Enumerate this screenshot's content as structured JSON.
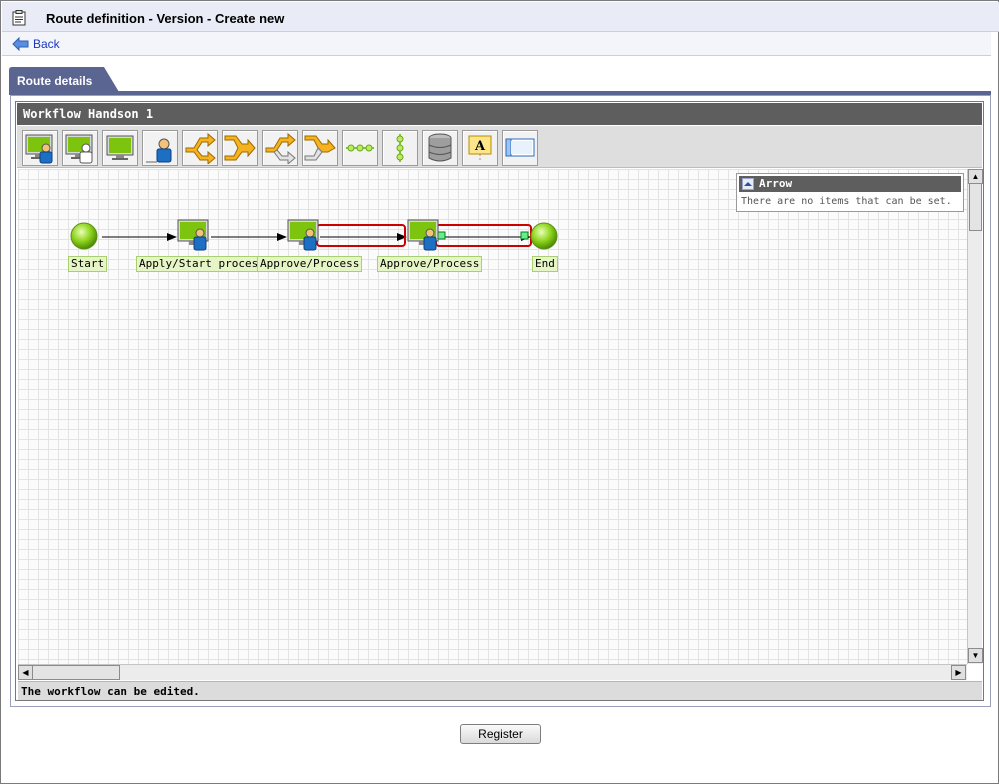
{
  "window": {
    "title": "Route definition - Version - Create new"
  },
  "nav": {
    "back_label": "Back"
  },
  "tabs": [
    {
      "label": "Route details"
    }
  ],
  "editor": {
    "workflow_title": "Workflow Handson 1",
    "toolbar_icons": [
      "apply-node-icon",
      "approve-node-icon",
      "process-node-icon",
      "user-node-icon",
      "branch-start-icon",
      "branch-end-icon",
      "parallel-branch-start-icon",
      "parallel-branch-end-icon",
      "horizontal-line-icon",
      "vertical-line-icon",
      "database-icon",
      "text-annotation-icon",
      "window-icon"
    ],
    "nodes": [
      {
        "label": "Start",
        "icon": "start-node-icon"
      },
      {
        "label": "Apply/Start process",
        "icon": "apply-node-icon"
      },
      {
        "label": "Approve/Process",
        "icon": "approve-node-icon"
      },
      {
        "label": "Approve/Process",
        "icon": "approve-node-icon"
      },
      {
        "label": "End",
        "icon": "end-node-icon"
      }
    ],
    "properties": {
      "title": "Arrow",
      "message": "There are no items that can be set."
    },
    "status": "The workflow can be edited."
  },
  "actions": {
    "register_label": "Register"
  },
  "colors": {
    "tab": "#5a6591",
    "header_dark": "#5e5e5e",
    "selection": "#cc0000",
    "node_green": "#7cc40e",
    "label_bg": "#e6f5c6"
  }
}
